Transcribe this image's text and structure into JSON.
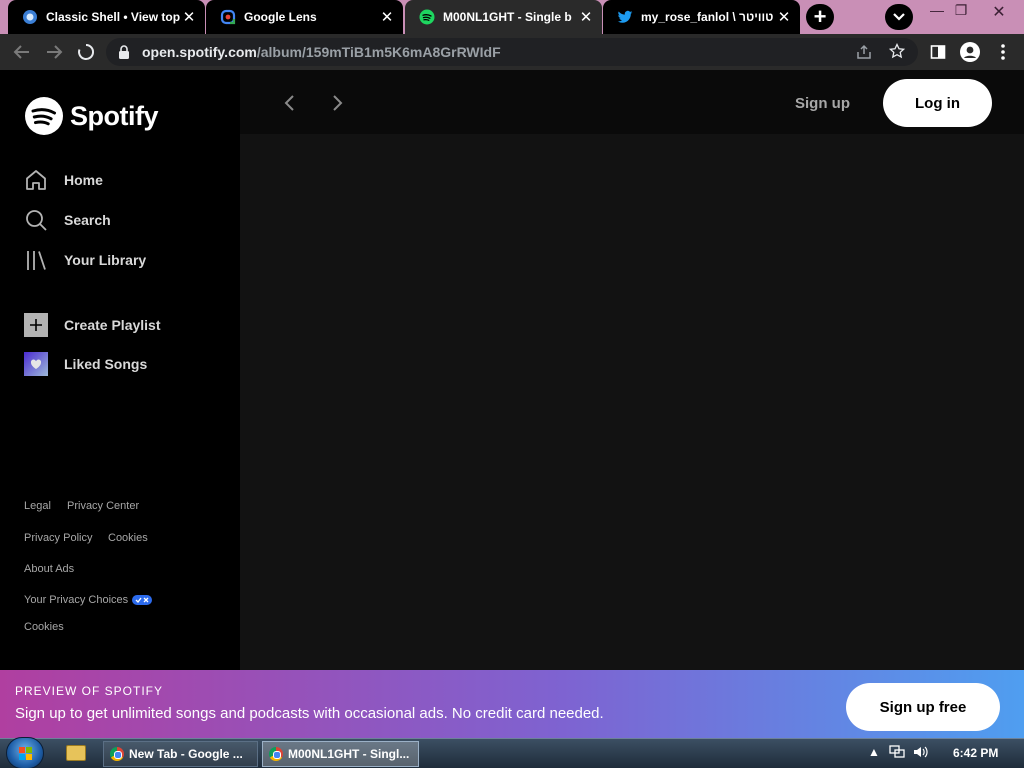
{
  "browser": {
    "tabs": [
      {
        "title": "Classic Shell • View top",
        "icon": "classic-shell-icon"
      },
      {
        "title": "Google Lens",
        "icon": "google-lens-icon"
      },
      {
        "title": "M00NL1GHT - Single b",
        "icon": "spotify-icon"
      },
      {
        "title": "my_rose_fanlol \\ טוויטר",
        "icon": "twitter-icon"
      }
    ],
    "active_tab_index": 2,
    "new_tab_label": "+",
    "url_host": "open.spotify.com",
    "url_path": "/album/159mTiB1m5K6mA8GrRWIdF"
  },
  "sidebar": {
    "brand": "Spotify",
    "nav": [
      {
        "label": "Home",
        "icon": "home-icon"
      },
      {
        "label": "Search",
        "icon": "search-icon"
      },
      {
        "label": "Your Library",
        "icon": "library-icon"
      }
    ],
    "actions": [
      {
        "label": "Create Playlist",
        "icon": "plus-icon"
      },
      {
        "label": "Liked Songs",
        "icon": "heart-icon"
      }
    ],
    "footer": {
      "legal": "Legal",
      "privacy_center": "Privacy Center",
      "privacy_policy": "Privacy Policy",
      "cookies": "Cookies",
      "about_ads": "About Ads",
      "privacy_choices": "Your Privacy Choices",
      "cookies_2": "Cookies"
    }
  },
  "header": {
    "signup": "Sign up",
    "login": "Log in"
  },
  "banner": {
    "kicker": "PREVIEW OF SPOTIFY",
    "message": "Sign up to get unlimited songs and podcasts with occasional ads. No credit card needed.",
    "cta": "Sign up free"
  },
  "taskbar": {
    "tasks": [
      {
        "title": "New Tab - Google ..."
      },
      {
        "title": "M00NL1GHT - Singl..."
      }
    ],
    "clock": "6:42 PM"
  }
}
